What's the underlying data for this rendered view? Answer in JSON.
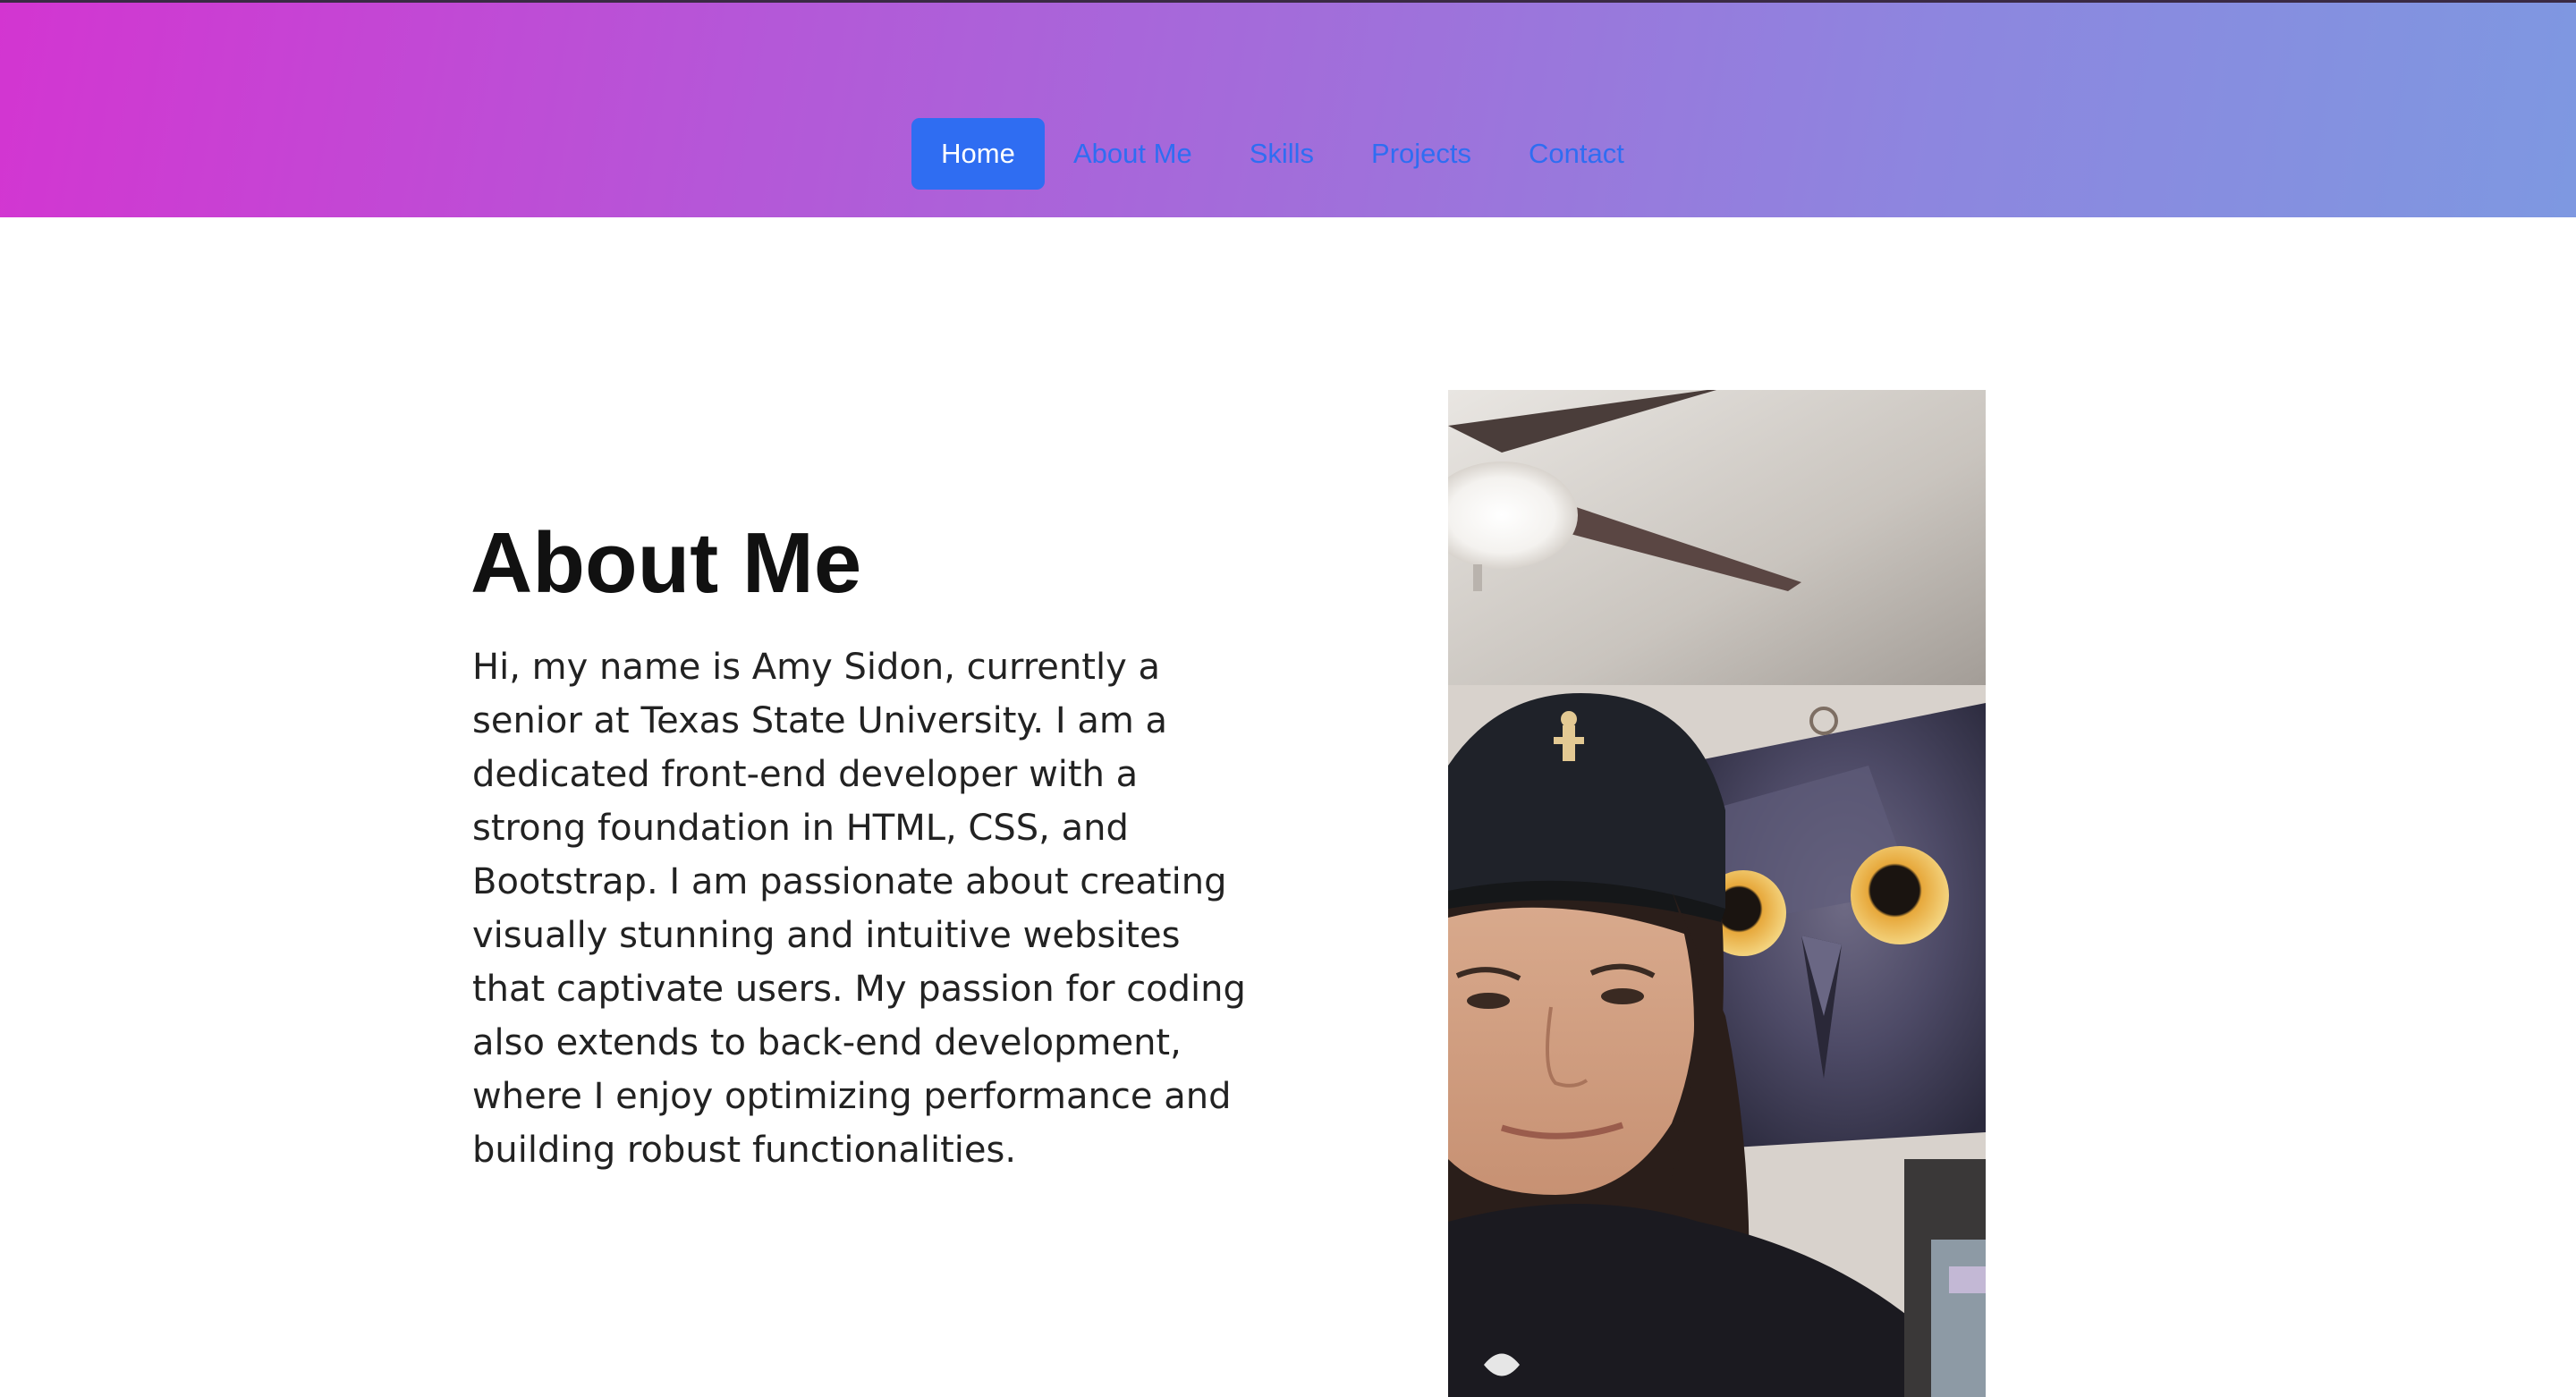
{
  "nav": {
    "items": [
      {
        "label": "Home",
        "active": true
      },
      {
        "label": "About Me",
        "active": false
      },
      {
        "label": "Skills",
        "active": false
      },
      {
        "label": "Projects",
        "active": false
      },
      {
        "label": "Contact",
        "active": false
      }
    ]
  },
  "about": {
    "title": "About Me",
    "paragraph": "Hi, my name is Amy Sidon, currently a senior at Texas State University. I am a dedicated front-end developer with a strong foundation in HTML, CSS, and Bootstrap. I am passionate about creating visually stunning and intuitive websites that captivate users. My passion for coding also extends to back-end development, where I enjoy optimizing performance and building robust functionalities."
  },
  "colors": {
    "gradient_start": "#d335d1",
    "gradient_end": "#7e98e1",
    "nav_link": "#2f6df2",
    "nav_active_bg": "#2f6df2"
  },
  "icons": {
    "photo": "profile-photo"
  }
}
